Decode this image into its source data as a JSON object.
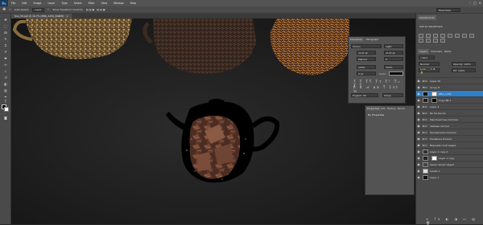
{
  "app": {
    "logo": "Ps",
    "menu": [
      "File",
      "Edit",
      "Image",
      "Layer",
      "Type",
      "Select",
      "Filter",
      "View",
      "Window",
      "Help"
    ],
    "window_buttons": [
      "–",
      "□",
      "×"
    ]
  },
  "options_bar": {
    "auto_select_label": "Auto-Select:",
    "auto_select_value": "Layer",
    "show_transform_label": "Show Transform Controls",
    "workspace": "Essentials"
  },
  "document_tab": {
    "title": "Sce_03.psd @ 16.7% (RBG_1250_RGB/8)",
    "close": "×"
  },
  "adjustments_panel": {
    "tab": "Adjustments",
    "subtitle": "Add an adjustment"
  },
  "character_panel": {
    "tabs": [
      "Character",
      "Paragraph"
    ],
    "font": "Chiron",
    "style": "Light",
    "size": "1147 pt",
    "leading": "1147 pt",
    "kerning": "Metrics",
    "tracking": "0",
    "vscale": "100%",
    "hscale": "100%",
    "baseline": "0 pt",
    "color_label": "Color:",
    "language": "English: UK",
    "aa": "Sharp"
  },
  "properties_panel": {
    "tabs": [
      "Properties",
      "Info",
      "History",
      "Brush"
    ],
    "message": "No Properties"
  },
  "layers_panel": {
    "tabs": [
      "Layers",
      "Channels",
      "Paths"
    ],
    "layers": [
      {
        "name": "Layer 20",
        "kind": "folder"
      },
      {
        "name": "Group 8",
        "kind": "folder"
      },
      {
        "name": "RBG_1250",
        "kind": "image"
      },
      {
        "name": "Copy 88 1",
        "kind": "image"
      },
      {
        "name": "Layer 3",
        "kind": "folder"
      },
      {
        "name": "No Sa Gia Sa",
        "kind": "folder"
      },
      {
        "name": "Маслянистые полоски",
        "kind": "folder"
      },
      {
        "name": "Чайные листья",
        "kind": "folder"
      },
      {
        "name": "Прозрачная колонка",
        "kind": "folder"
      },
      {
        "name": "Название блоков",
        "kind": "folder"
      },
      {
        "name": "Верхний слой кадра",
        "kind": "folder"
      },
      {
        "name": "Layer 1 copy 2",
        "kind": "image"
      },
      {
        "name": "Layer 1 copy",
        "kind": "image"
      },
      {
        "name": "Vector Smart Object",
        "kind": "image"
      },
      {
        "name": "Levels 1",
        "kind": "adjust"
      },
      {
        "name": "Layer 1",
        "kind": "image"
      }
    ]
  },
  "colors": {
    "accent": "#2f80c8",
    "tea_dark": "#3a2a22",
    "tea_gold": "#9a7d4e",
    "tea_orange": "#a65e2e"
  }
}
